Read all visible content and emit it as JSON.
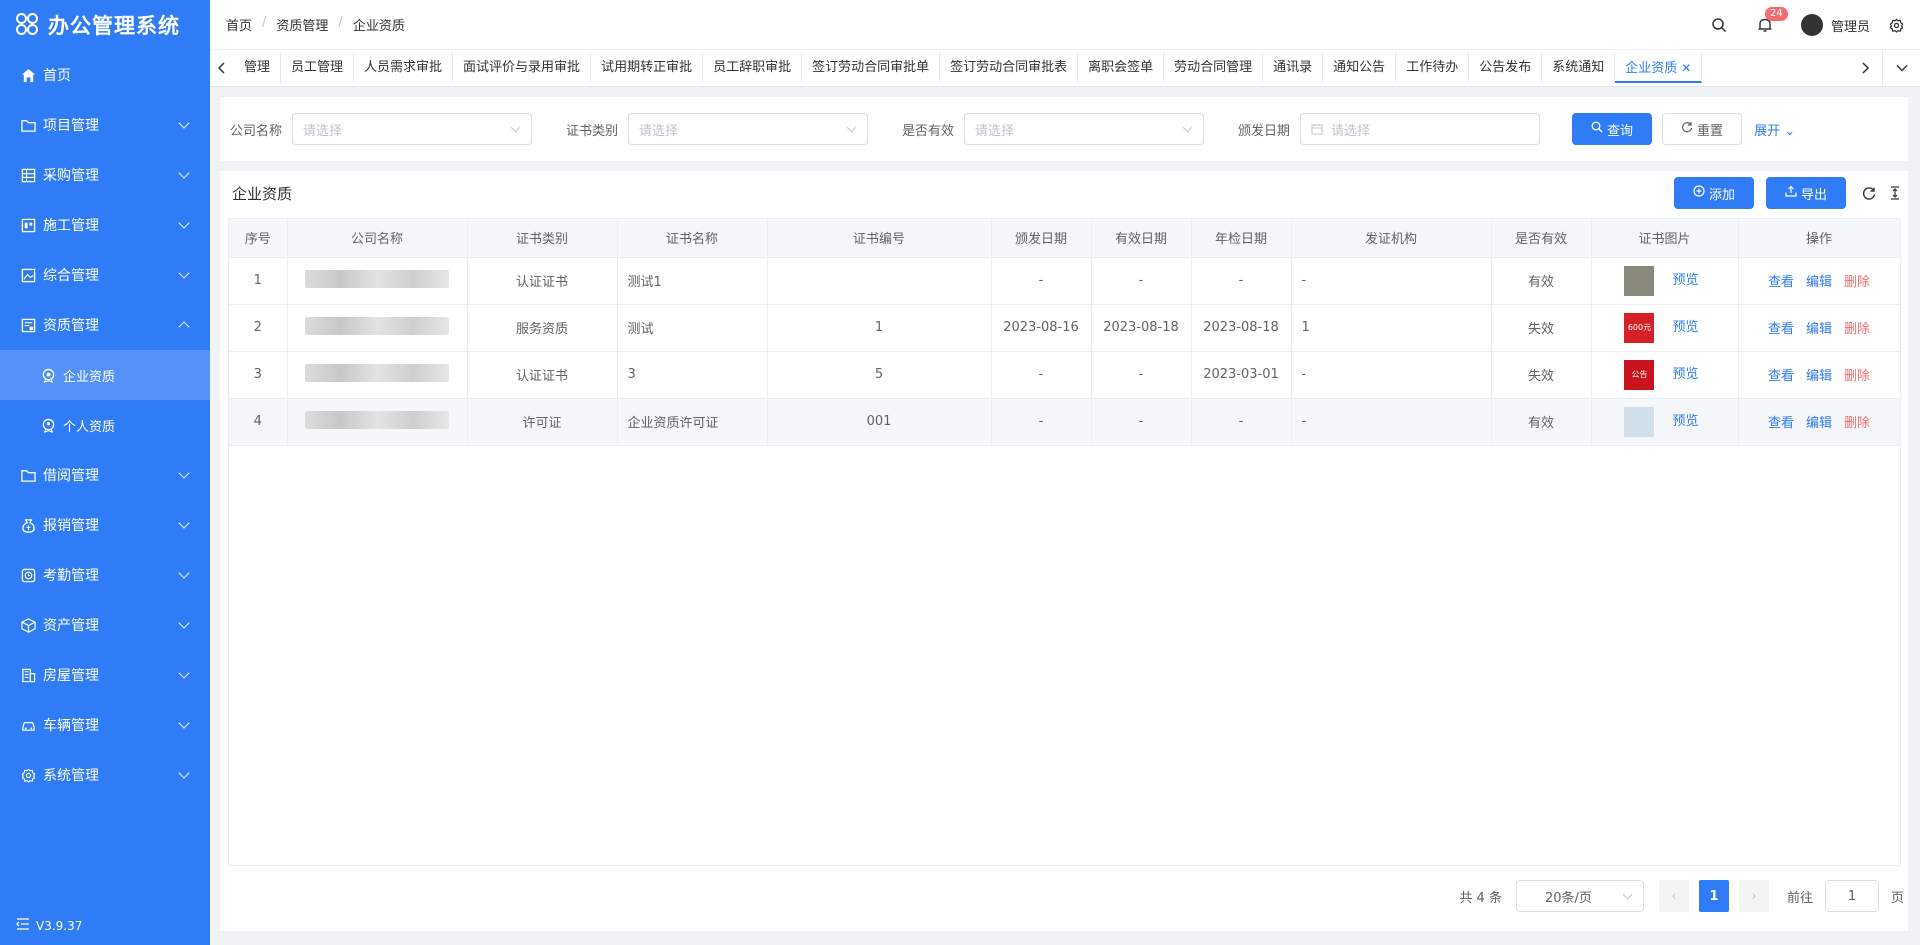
{
  "app": {
    "title": "办公管理系统",
    "version": "V3.9.37"
  },
  "sidebar": {
    "items": [
      {
        "label": "首页",
        "icon": "home-icon"
      },
      {
        "label": "项目管理",
        "icon": "folder-icon"
      },
      {
        "label": "采购管理",
        "icon": "grid-icon"
      },
      {
        "label": "施工管理",
        "icon": "board-icon"
      },
      {
        "label": "综合管理",
        "icon": "image-icon"
      },
      {
        "label": "资质管理",
        "icon": "certificate-icon"
      },
      {
        "label": "企业资质",
        "icon": "company-icon"
      },
      {
        "label": "个人资质",
        "icon": "person-icon"
      },
      {
        "label": "借阅管理",
        "icon": "folder-icon"
      },
      {
        "label": "报销管理",
        "icon": "money-bag-icon"
      },
      {
        "label": "考勤管理",
        "icon": "clock-icon"
      },
      {
        "label": "资产管理",
        "icon": "cube-icon"
      },
      {
        "label": "房屋管理",
        "icon": "building-icon"
      },
      {
        "label": "车辆管理",
        "icon": "car-icon"
      },
      {
        "label": "系统管理",
        "icon": "gear-icon"
      }
    ]
  },
  "header": {
    "breadcrumb": [
      "首页",
      "资质管理",
      "企业资质"
    ],
    "notification_count": "24",
    "username": "管理员"
  },
  "tags": [
    "管理",
    "员工管理",
    "人员需求审批",
    "面试评价与录用审批",
    "试用期转正审批",
    "员工辞职审批",
    "签订劳动合同审批单",
    "签订劳动合同审批表",
    "离职会签单",
    "劳动合同管理",
    "通讯录",
    "通知公告",
    "工作待办",
    "公告发布",
    "系统通知",
    "企业资质"
  ],
  "search": {
    "company_label": "公司名称",
    "company_placeholder": "请选择",
    "cert_type_label": "证书类别",
    "cert_type_placeholder": "请选择",
    "valid_label": "是否有效",
    "valid_placeholder": "请选择",
    "date_label": "颁发日期",
    "date_placeholder": "请选择",
    "query_label": "查询",
    "reset_label": "重置",
    "expand_label": "展开"
  },
  "card": {
    "title": "企业资质",
    "add_label": "添加",
    "export_label": "导出"
  },
  "table": {
    "columns": [
      "序号",
      "公司名称",
      "证书类别",
      "证书名称",
      "证书编号",
      "颁发日期",
      "有效日期",
      "年检日期",
      "发证机构",
      "是否有效",
      "证书图片",
      "操作"
    ],
    "rows": [
      {
        "no": "1",
        "cert_type": "认证证书",
        "cert_name": "测试1",
        "cert_no": "",
        "issue": "-",
        "valid_until": "-",
        "inspect": "-",
        "org": "-",
        "valid": "有效",
        "thumb_color": "#8a8a7a",
        "thumb_text": ""
      },
      {
        "no": "2",
        "cert_type": "服务资质",
        "cert_name": "测试",
        "cert_no": "1",
        "issue": "2023-08-16",
        "valid_until": "2023-08-18",
        "inspect": "2023-08-18",
        "org": "1",
        "valid": "失效",
        "thumb_color": "#d61f26",
        "thumb_text": "600元"
      },
      {
        "no": "3",
        "cert_type": "认证证书",
        "cert_name": "3",
        "cert_no": "5",
        "issue": "-",
        "valid_until": "-",
        "inspect": "2023-03-01",
        "org": "-",
        "valid": "失效",
        "thumb_color": "#c8141e",
        "thumb_text": "公告"
      },
      {
        "no": "4",
        "cert_type": "许可证",
        "cert_name": "企业资质许可证",
        "cert_no": "001",
        "issue": "-",
        "valid_until": "-",
        "inspect": "-",
        "org": "-",
        "valid": "有效",
        "thumb_color": "#cfe0ea",
        "thumb_text": ""
      }
    ],
    "preview_label": "预览",
    "view_label": "查看",
    "edit_label": "编辑",
    "delete_label": "删除"
  },
  "pagination": {
    "total_text": "共 4 条",
    "page_size": "20条/页",
    "current": "1",
    "goto_label": "前往",
    "goto_value": "1",
    "page_suffix": "页"
  },
  "colors": {
    "primary": "#2f7cf6",
    "danger": "#f56c6c",
    "sidebar_active": "#5492f7"
  }
}
